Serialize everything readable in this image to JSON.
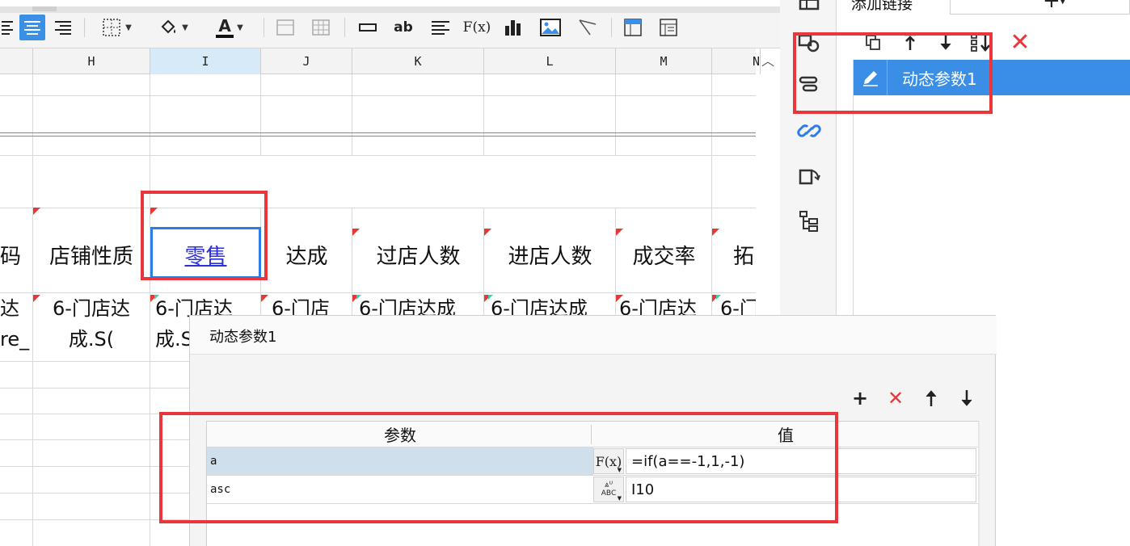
{
  "toolbar": {
    "font_color_letter": "A",
    "text_tool_label": "ab",
    "formula_label": "F(x)"
  },
  "columns": [
    {
      "id": "H",
      "label": "H"
    },
    {
      "id": "I",
      "label": "I"
    },
    {
      "id": "J",
      "label": "J"
    },
    {
      "id": "K",
      "label": "K"
    },
    {
      "id": "L",
      "label": "L"
    },
    {
      "id": "M",
      "label": "M"
    },
    {
      "id": "N",
      "label": "N"
    }
  ],
  "headers_row": {
    "partial_left": "码",
    "H": "店铺性质",
    "I": "零售",
    "J": "达成",
    "K": "过店人数",
    "L": "进店人数",
    "M": "成交率",
    "N": "拓"
  },
  "data_row": {
    "partial_left_line1": "达",
    "partial_left_line2": "re_",
    "H_line1": "6-门店达",
    "H_line2": "成.S(",
    "I_line1": "6-门店达",
    "I_line2": "成.S",
    "J_line1": "6-门店",
    "K_line1": "6-门店达成",
    "L_line1": "6-门店达成",
    "M_line1": "6-门店达",
    "N_line1": "6-门"
  },
  "right_panel": {
    "title": "添加链接",
    "selected_item": "动态参数1"
  },
  "dialog": {
    "title": "动态参数1",
    "header_param": "参数",
    "header_value": "值",
    "rows": [
      {
        "name": "a",
        "type_label": "F(x)",
        "value": "=if(a==-1,1,-1)"
      },
      {
        "name": "asc",
        "type_label": "ABC",
        "value": "I10"
      }
    ]
  },
  "colors": {
    "accent_blue": "#3b8ee5",
    "highlight_red": "#e8363a",
    "link_blue": "#2b30d8"
  }
}
